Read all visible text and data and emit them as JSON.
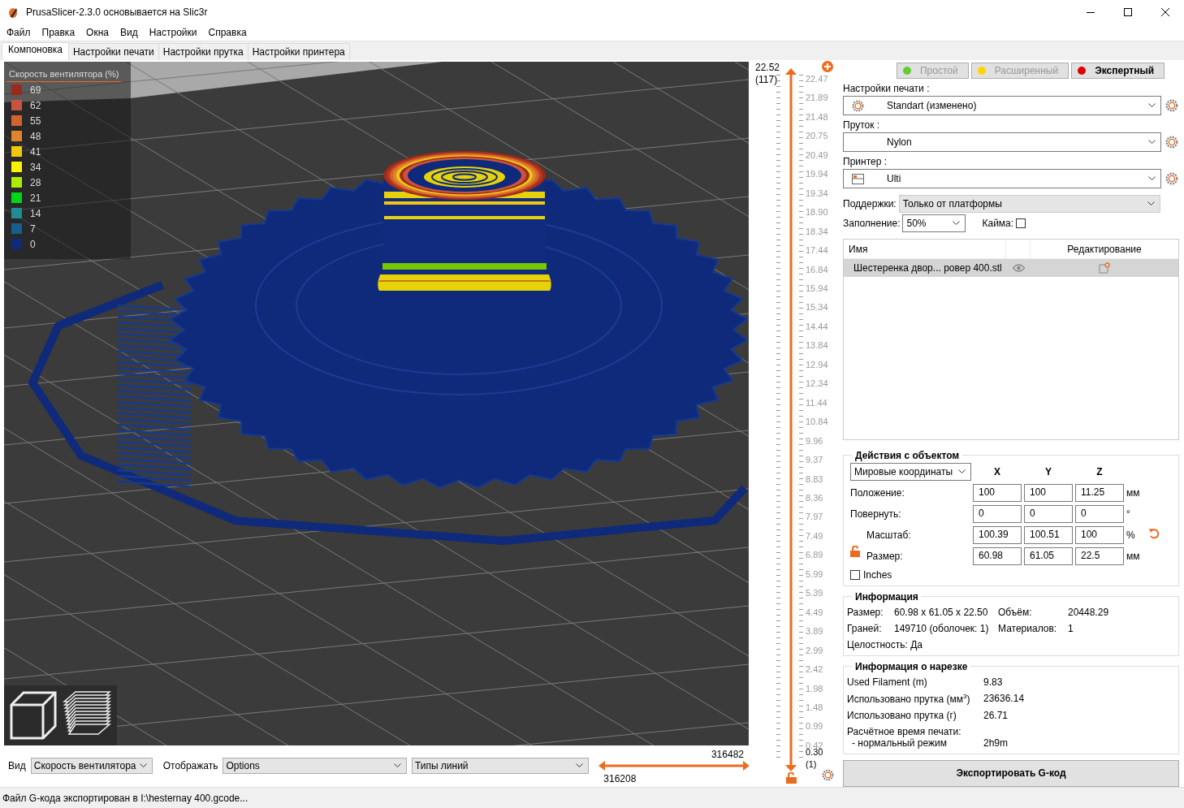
{
  "window": {
    "title": "PrusaSlicer-2.3.0 основывается на Slic3r"
  },
  "menu": [
    "Файл",
    "Правка",
    "Окна",
    "Вид",
    "Настройки",
    "Справка"
  ],
  "tabs": [
    {
      "label": "Компоновка",
      "selected": true
    },
    {
      "label": "Настройки печати",
      "selected": false
    },
    {
      "label": "Настройки прутка",
      "selected": false
    },
    {
      "label": "Настройки принтера",
      "selected": false
    }
  ],
  "legend": {
    "title": "Скорость вентилятора (%)",
    "items": [
      {
        "label": "69",
        "color": "#9b2a1d"
      },
      {
        "label": "62",
        "color": "#c9533f"
      },
      {
        "label": "55",
        "color": "#d2652f"
      },
      {
        "label": "48",
        "color": "#e0862a"
      },
      {
        "label": "41",
        "color": "#f2c80e"
      },
      {
        "label": "34",
        "color": "#fff200"
      },
      {
        "label": "28",
        "color": "#aaee00"
      },
      {
        "label": "21",
        "color": "#00d619"
      },
      {
        "label": "14",
        "color": "#1e8d95"
      },
      {
        "label": "7",
        "color": "#145f8e"
      },
      {
        "label": "0",
        "color": "#0f2a7a"
      }
    ]
  },
  "layer_slider": {
    "top_value": "22.52",
    "top_layer": "(117)",
    "ticks": [
      "22.47",
      "21.89",
      "21.48",
      "20.75",
      "20.49",
      "19.94",
      "19.34",
      "18.90",
      "18.34",
      "17.44",
      "16.84",
      "15.94",
      "15.34",
      "14.44",
      "13.84",
      "12.94",
      "12.34",
      "11.44",
      "10.84",
      "9.96",
      "9.37",
      "8.83",
      "8.36",
      "7.97",
      "7.49",
      "6.89",
      "5.99",
      "5.39",
      "4.49",
      "3.89",
      "2.99",
      "2.42",
      "1.98",
      "1.48",
      "0.99",
      "0.42"
    ],
    "bottom_value": "0.30",
    "bottom_layer": "(1)",
    "thumbs": [
      {
        "level": 1
      },
      {
        "level": 0
      }
    ]
  },
  "bottom_bar": {
    "view_label": "Вид",
    "view_value": "Скорость вентилятора",
    "show_label": "Отображать",
    "show_value": "Options",
    "line_types": "Типы линий",
    "range_end": "316482",
    "range_start": "316208",
    "thumbs": [
      {
        "level": 0
      },
      {
        "level": 1
      }
    ]
  },
  "sidebar": {
    "modes": [
      {
        "label": "Простой",
        "color": "#66cc33",
        "selected": false
      },
      {
        "label": "Расширенный",
        "color": "#ffd500",
        "selected": false
      },
      {
        "label": "Экспертный",
        "color": "#e00000",
        "selected": true
      }
    ],
    "presets": [
      {
        "kind": "print",
        "label": "Настройки печати :",
        "value": "Standart (изменено)"
      },
      {
        "kind": "filament",
        "label": "Пруток :",
        "value": "Nylon"
      },
      {
        "kind": "printer",
        "label": "Принтер :",
        "value": "Ulti"
      }
    ],
    "supports": {
      "label": "Поддержки:",
      "value": "Только от платформы"
    },
    "infill": {
      "label": "Заполнение:",
      "value": "50%"
    },
    "brim": {
      "label": "Кайма:",
      "checked": false
    },
    "object_list": {
      "columns": [
        "Имя",
        "Редактирование"
      ],
      "rows": [
        {
          "name": "Шестеренка двор... ровер 400.stl",
          "selected": true
        }
      ]
    },
    "manipulation": {
      "title": "Действия с объектом",
      "coordinates": "Мировые координаты",
      "axes": [
        "X",
        "Y",
        "Z"
      ],
      "rows": [
        {
          "label": "Положение:",
          "values": [
            "100",
            "100",
            "11.25"
          ],
          "unit": "мм"
        },
        {
          "label": "Повернуть:",
          "values": [
            "0",
            "0",
            "0"
          ],
          "unit": "°"
        },
        {
          "label": "Масштаб:",
          "values": [
            "100.39",
            "100.51",
            "100"
          ],
          "unit": "%"
        },
        {
          "label": "Размер:",
          "values": [
            "60.98",
            "61.05",
            "22.5"
          ],
          "unit": "мм"
        }
      ],
      "inches": {
        "label": "Inches",
        "checked": false
      }
    },
    "info": {
      "title": "Информация",
      "size_label": "Размер:",
      "size": "60.98 x 61.05 x 22.50",
      "volume_label": "Объём:",
      "volume": "20448.29",
      "facets_label": "Граней:",
      "facets": "149710 (оболочек: 1)",
      "materials_label": "Материалов:",
      "materials": "1",
      "manifold": "Целостность: Да"
    },
    "slice_info": {
      "title": "Информация о нарезке",
      "rows": [
        {
          "label": "Used Filament (m)",
          "value": "9.83"
        },
        {
          "label": "Использовано прутка (мм$^{3}$)",
          "value": "23636.14"
        },
        {
          "label": "Использовано прутка (г)",
          "value": "26.71"
        }
      ],
      "time_label": "Расчётное время печати:",
      "mode_label": "- нормальный режим",
      "time": "2h9m"
    },
    "export_button": "Экспортировать G-код"
  },
  "status_bar": "Файл G-кода экспортирован в I:\\hesternay 400.gcode..."
}
